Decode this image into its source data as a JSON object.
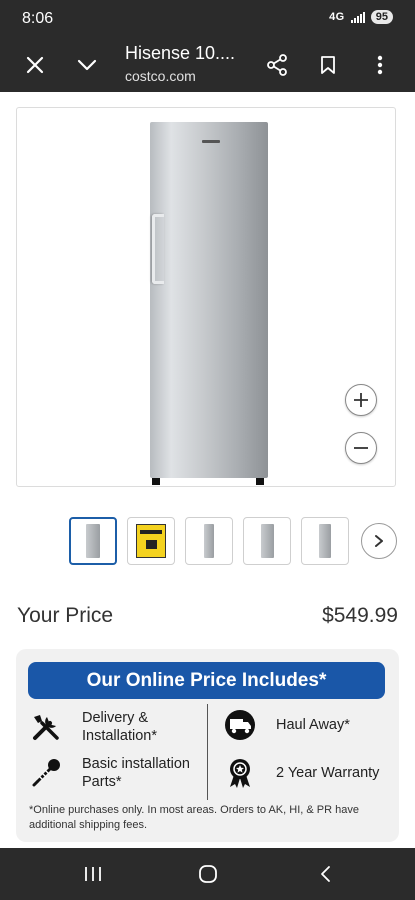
{
  "status_bar": {
    "time": "8:06",
    "network": "4G",
    "battery": "95"
  },
  "browser": {
    "page_title": "Hisense 10....",
    "url": "costco.com",
    "icons": [
      "close-icon",
      "chevron-down-icon",
      "share-icon",
      "bookmark-icon",
      "more-vert-icon"
    ]
  },
  "product": {
    "image_icons": [
      "zoom-in-icon",
      "zoom-out-icon"
    ],
    "thumbnail_count": 5,
    "active_thumbnail": 1,
    "next_icon": "chevron-right-icon"
  },
  "price": {
    "label": "Your Price",
    "value": "$549.99"
  },
  "includes": {
    "header": "Our Online Price Includes*",
    "items": [
      {
        "icon": "tools-icon",
        "line1": "Delivery &",
        "line2": "Installation*"
      },
      {
        "icon": "truck-icon",
        "line1": "Haul Away*",
        "line2": ""
      },
      {
        "icon": "screw-icon",
        "line1": "Basic installation",
        "line2": "Parts*"
      },
      {
        "icon": "ribbon-icon",
        "line1": "2 Year Warranty",
        "line2": ""
      }
    ],
    "note": "*Online purchases only. In most areas. Orders to AK, HI, & PR have additional shipping fees."
  },
  "colors": {
    "accent": "#1a57a8",
    "chrome": "#2b2b2b"
  },
  "system_nav": [
    "recents-icon",
    "home-icon",
    "back-icon"
  ]
}
